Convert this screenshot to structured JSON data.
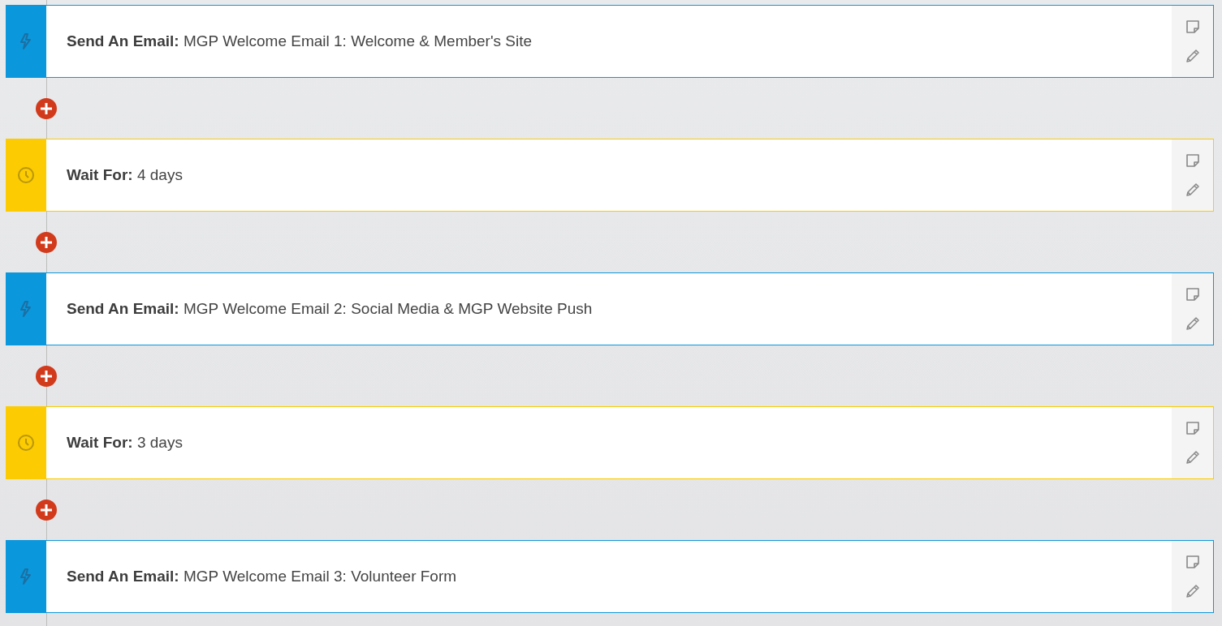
{
  "steps": [
    {
      "kind": "email",
      "text": "**Send An Email:** MGP Welcome Email 1: Welcome & Member's Site"
    },
    {
      "kind": "wait",
      "text": "**Wait For:** 4 days"
    },
    {
      "kind": "email",
      "text": "**Send An Email:** MGP Welcome Email 2: Social Media & MGP Website Push"
    },
    {
      "kind": "wait",
      "text": "**Wait For:** 3 days"
    },
    {
      "kind": "email",
      "text": "**Send An Email:** MGP Welcome Email 3: Volunteer Form"
    }
  ]
}
